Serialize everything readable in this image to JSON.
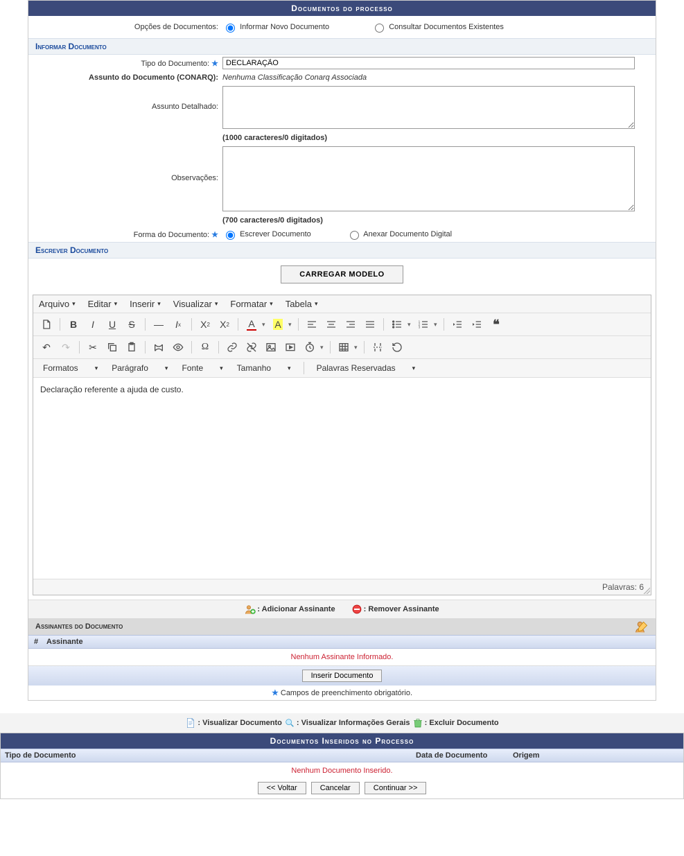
{
  "header": {
    "title": "Documentos do processo"
  },
  "options": {
    "label": "Opções de Documentos:",
    "inform": "Informar Novo Documento",
    "consult": "Consultar Documentos Existentes"
  },
  "sec_inform": "Informar Documento",
  "fields": {
    "tipo_label": "Tipo do Documento:",
    "tipo_value": "DECLARAÇÃO",
    "conarq_label": "Assunto do Documento (CONARQ):",
    "conarq_value": "Nenhuma Classificação Conarq Associada",
    "assunto_label": "Assunto Detalhado:",
    "assunto_counter": "(1000 caracteres/0 digitados)",
    "obs_label": "Observações:",
    "obs_counter": "(700 caracteres/0 digitados)",
    "forma_label": "Forma do Documento:",
    "forma_write": "Escrever Documento",
    "forma_attach": "Anexar Documento Digital"
  },
  "sec_write": "Escrever Documento",
  "load_model": "CARREGAR MODELO",
  "editor": {
    "menu": {
      "file": "Arquivo",
      "edit": "Editar",
      "insert": "Inserir",
      "view": "Visualizar",
      "format": "Formatar",
      "table": "Tabela"
    },
    "fmt": {
      "formats": "Formatos",
      "paragraph": "Parágrafo",
      "font": "Fonte",
      "size": "Tamanho",
      "reserved": "Palavras Reservadas"
    },
    "body": "Declaração referente a ajuda de custo.",
    "words_label": "Palavras:",
    "words": "6"
  },
  "legend": {
    "add": "Adicionar Assinante",
    "remove": "Remover Assinante"
  },
  "signers": {
    "title": "Assinantes do Documento",
    "col_num": "#",
    "col_name": "Assinante",
    "empty": "Nenhum Assinante Informado."
  },
  "insert_doc": "Inserir Documento",
  "required_note": "Campos de preenchimento obrigatório.",
  "midlegend": {
    "view_doc": "Visualizar Documento",
    "view_info": "Visualizar Informações Gerais",
    "delete_doc": "Excluir Documento"
  },
  "inserted": {
    "title": "Documentos Inseridos no Processo",
    "col_type": "Tipo de Documento",
    "col_date": "Data de Documento",
    "col_origin": "Origem",
    "empty": "Nenhum Documento Inserido."
  },
  "actions": {
    "back": "<< Voltar",
    "cancel": "Cancelar",
    "next": "Continuar >>"
  },
  "icons": {
    "adduser": "add-user-icon",
    "remove": "remove-icon",
    "sign": "sign-icon",
    "doc": "document-icon",
    "search": "magnifier-icon",
    "trash": "trash-icon"
  }
}
